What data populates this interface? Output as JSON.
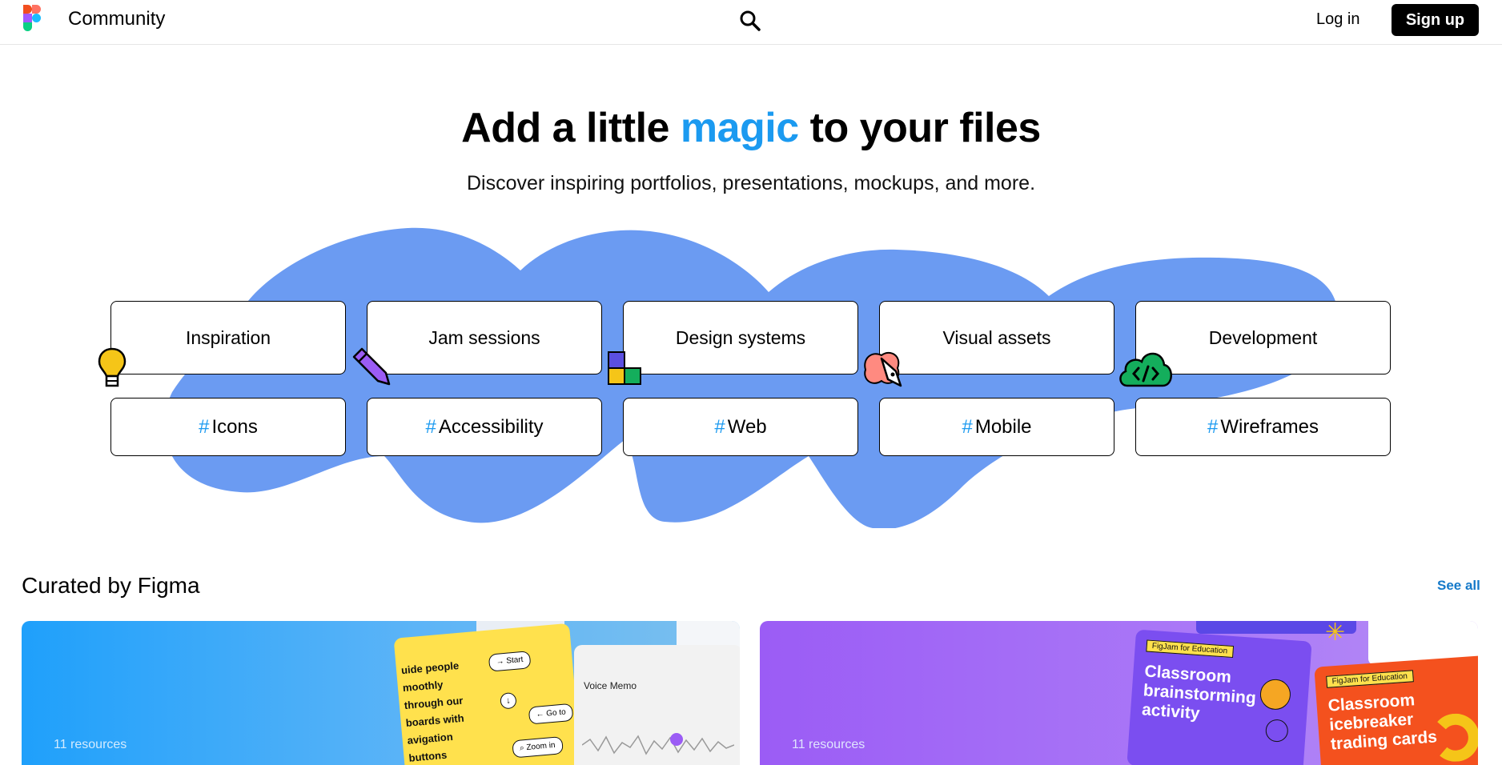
{
  "header": {
    "brand": "Community",
    "login_label": "Log in",
    "signup_label": "Sign up"
  },
  "hero": {
    "title_prefix": "Add a little ",
    "title_highlight": "magic",
    "title_suffix": " to your files",
    "subtitle": "Discover inspiring portfolios, presentations, mockups, and more."
  },
  "categories": [
    "Inspiration",
    "Jam sessions",
    "Design systems",
    "Visual assets",
    "Development"
  ],
  "tags": [
    "Icons",
    "Accessibility",
    "Web",
    "Mobile",
    "Wireframes"
  ],
  "icons": [
    "lightbulb-icon",
    "pencil-icon",
    "blocks-icon",
    "pen-tool-icon",
    "cloud-code-icon",
    "search-icon",
    "figma-logo-icon"
  ],
  "colors": {
    "accent": "#1b9af0",
    "blob": "#6b9bf2",
    "link": "#1479c9"
  },
  "curated": {
    "title": "Curated by Figma",
    "see_all": "See all",
    "cards": [
      {
        "count_label": "11 resources",
        "thumb_text": "uide people moothly through our boards with avigation buttons",
        "chip_start": "Start",
        "chip_goto": "Go to",
        "chip_zoom": "Zoom in",
        "memo_label": "Voice Memo"
      },
      {
        "count_label": "11 resources",
        "badge": "FigJam for Education",
        "card1_title": "Classroom brainstorming activity",
        "card2_title": "Classroom icebreaker trading cards"
      }
    ]
  }
}
